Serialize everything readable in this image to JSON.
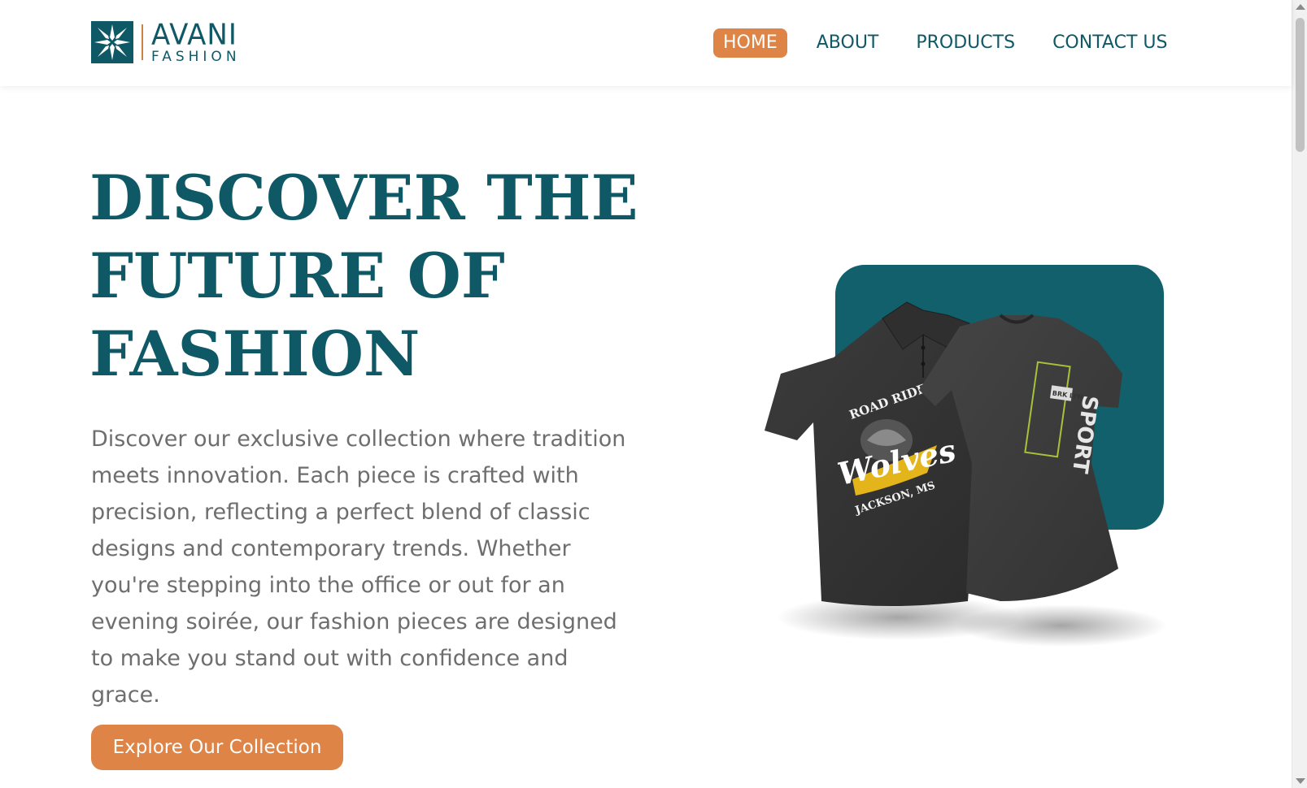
{
  "brand": {
    "name": "AVANI",
    "tagline": "FASHION",
    "colors": {
      "primary": "#0f5966",
      "accent": "#dd8446",
      "card": "#11606c"
    }
  },
  "nav": {
    "items": [
      {
        "label": "HOME",
        "active": true
      },
      {
        "label": "ABOUT",
        "active": false
      },
      {
        "label": "PRODUCTS",
        "active": false
      },
      {
        "label": "CONTACT US",
        "active": false
      }
    ]
  },
  "hero": {
    "title_line1": "DISCOVER THE",
    "title_line2": "FUTURE OF",
    "title_line3": "FASHION",
    "description": "Discover our exclusive collection where tradition meets innovation. Each piece is crafted with precision, reflecting a perfect blend of classic designs and contemporary trends. Whether you're stepping into the office or out for an evening soirée, our fashion pieces are designed to make you stand out with confidence and grace.",
    "cta_label": "Explore Our Collection"
  },
  "product_image": {
    "polo_print_top": "ROAD RIDE",
    "polo_print_main": "Wolves",
    "polo_print_bottom": "JACKSON, MS",
    "tee_print": "SPORT",
    "tee_badge": "BRK LYN"
  },
  "icons": {
    "logo": "snowflake-logo-icon",
    "scroll_up": "scroll-up-arrow-icon",
    "scroll_down": "scroll-down-arrow-icon"
  }
}
